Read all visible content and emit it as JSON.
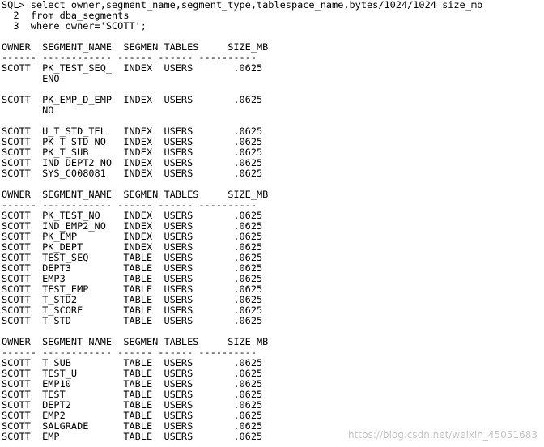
{
  "query": {
    "lines": [
      "SQL> select owner,segment_name,segment_type,tablespace_name,bytes/1024/1024 size_mb",
      "  2  from dba_segments",
      "  3  where owner='SCOTT';"
    ]
  },
  "header": {
    "titles": "OWNER  SEGMENT_NAME  SEGMEN TABLES     SIZE_MB",
    "underline": "------ ------------ ------ ------ ----------"
  },
  "blocks": [
    {
      "lines": [
        "SCOTT  PK_TEST_SEQ_  INDEX  USERS       .0625",
        "       ENO"
      ]
    },
    {
      "lines": [
        "SCOTT  PK_EMP_D_EMP  INDEX  USERS       .0625",
        "       NO"
      ]
    },
    {
      "lines": [
        "SCOTT  U_T_STD_TEL   INDEX  USERS       .0625",
        "SCOTT  PK_T_STD_NO   INDEX  USERS       .0625",
        "SCOTT  PK_T_SUB      INDEX  USERS       .0625",
        "SCOTT  IND_DEPT2_NO  INDEX  USERS       .0625",
        "SCOTT  SYS_C008081   INDEX  USERS       .0625"
      ]
    },
    {
      "header": true,
      "lines": [
        "SCOTT  PK_TEST_NO    INDEX  USERS       .0625",
        "SCOTT  IND_EMP2_NO   INDEX  USERS       .0625",
        "SCOTT  PK_EMP        INDEX  USERS       .0625",
        "SCOTT  PK_DEPT       INDEX  USERS       .0625",
        "SCOTT  TEST_SEQ      TABLE  USERS       .0625",
        "SCOTT  DEPT3         TABLE  USERS       .0625",
        "SCOTT  EMP3          TABLE  USERS       .0625",
        "SCOTT  TEST_EMP      TABLE  USERS       .0625",
        "SCOTT  T_STD2        TABLE  USERS       .0625",
        "SCOTT  T_SCORE       TABLE  USERS       .0625",
        "SCOTT  T_STD         TABLE  USERS       .0625"
      ]
    },
    {
      "header": true,
      "lines": [
        "SCOTT  T_SUB         TABLE  USERS       .0625",
        "SCOTT  TEST_U        TABLE  USERS       .0625",
        "SCOTT  EMP10         TABLE  USERS       .0625",
        "SCOTT  TEST          TABLE  USERS       .0625",
        "SCOTT  DEPT2         TABLE  USERS       .0625",
        "SCOTT  EMP2          TABLE  USERS       .0625",
        "SCOTT  SALGRADE      TABLE  USERS       .0625",
        "SCOTT  EMP           TABLE  USERS       .0625"
      ]
    }
  ],
  "watermark": "https://blog.csdn.net/weixin_45051683"
}
